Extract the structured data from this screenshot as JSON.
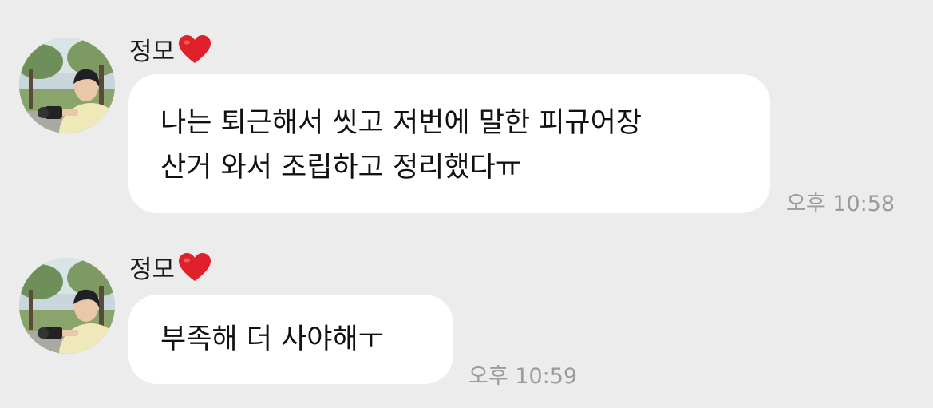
{
  "messages": [
    {
      "sender": "정모",
      "heart_icon": "red-heart-icon",
      "lines": [
        "나는 퇴근해서 씻고 저번에 말한 피규어장",
        "산거 와서 조립하고 정리했다ㅠ"
      ],
      "time": "오후 10:58"
    },
    {
      "sender": "정모",
      "heart_icon": "red-heart-icon",
      "lines": [
        "부족해 더 사야해ㅜ"
      ],
      "time": "오후 10:59"
    }
  ],
  "colors": {
    "background": "#ececec",
    "bubble": "#ffffff",
    "heart": "#e0202a",
    "time_text": "#9b9b9b"
  }
}
